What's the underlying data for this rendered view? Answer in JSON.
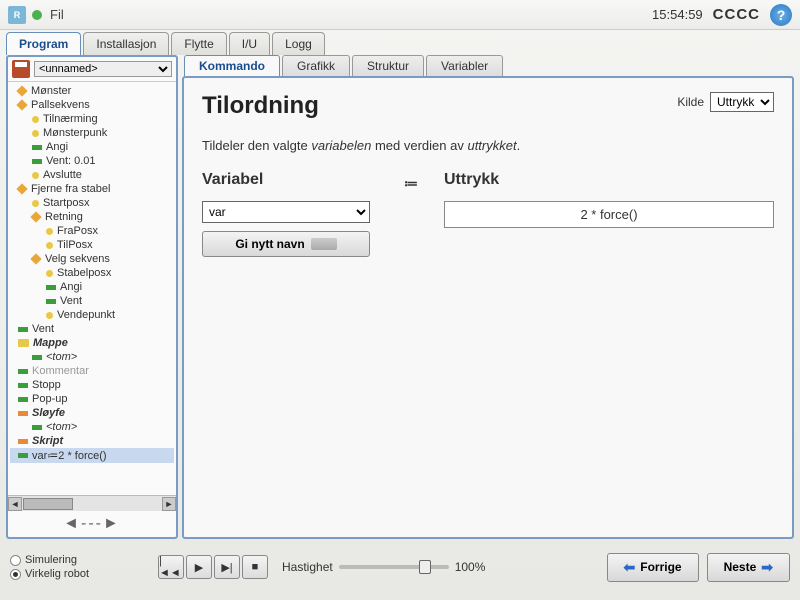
{
  "topbar": {
    "file_menu": "Fil",
    "clock": "15:54:59",
    "status_text": "CCCC",
    "help": "?"
  },
  "main_tabs": [
    "Program",
    "Installasjon",
    "Flytte",
    "I/U",
    "Logg"
  ],
  "program_name": "<unnamed>",
  "tree": [
    {
      "d": 0,
      "t": "diamond",
      "label": "Mønster"
    },
    {
      "d": 0,
      "t": "diamond",
      "label": "Pallsekvens"
    },
    {
      "d": 1,
      "t": "dot",
      "label": "Tilnærming"
    },
    {
      "d": 1,
      "t": "dot",
      "label": "Mønsterpunk"
    },
    {
      "d": 1,
      "t": "barg",
      "label": "Angi"
    },
    {
      "d": 1,
      "t": "barg",
      "label": "Vent: 0.01"
    },
    {
      "d": 1,
      "t": "dot",
      "label": "Avslutte"
    },
    {
      "d": 0,
      "t": "diamond",
      "label": "Fjerne fra stabel"
    },
    {
      "d": 1,
      "t": "dot",
      "label": "Startposx"
    },
    {
      "d": 1,
      "t": "diamond",
      "label": "Retning"
    },
    {
      "d": 2,
      "t": "dot",
      "label": "FraPosx"
    },
    {
      "d": 2,
      "t": "dot",
      "label": "TilPosx"
    },
    {
      "d": 1,
      "t": "diamond",
      "label": "Velg sekvens"
    },
    {
      "d": 2,
      "t": "dot",
      "label": "Stabelposx"
    },
    {
      "d": 2,
      "t": "barg",
      "label": "Angi"
    },
    {
      "d": 2,
      "t": "barg",
      "label": "Vent"
    },
    {
      "d": 2,
      "t": "dot",
      "label": "Vendepunkt"
    },
    {
      "d": 0,
      "t": "barg",
      "label": "Vent",
      "nodepth": true
    },
    {
      "d": 0,
      "t": "folder",
      "label": "Mappe",
      "bold": true,
      "nodepth": true
    },
    {
      "d": 1,
      "t": "barg",
      "label": "<tom>",
      "ital": true
    },
    {
      "d": 0,
      "t": "barg",
      "label": "Kommentar",
      "nodepth": true,
      "grey": true
    },
    {
      "d": 0,
      "t": "barg",
      "label": "Stopp",
      "nodepth": true
    },
    {
      "d": 0,
      "t": "barg",
      "label": "Pop-up",
      "nodepth": true
    },
    {
      "d": 0,
      "t": "baro",
      "label": "Sløyfe",
      "bold": true,
      "nodepth": true
    },
    {
      "d": 1,
      "t": "barg",
      "label": "<tom>",
      "ital": true
    },
    {
      "d": 0,
      "t": "baro",
      "label": "Skript",
      "bold": true,
      "nodepth": true
    },
    {
      "d": 0,
      "t": "barg",
      "label": "var≔2 * force()",
      "nodepth": true,
      "sel": true
    }
  ],
  "sub_tabs": [
    "Kommando",
    "Grafikk",
    "Struktur",
    "Variabler"
  ],
  "content": {
    "kilde_label": "Kilde",
    "kilde_value": "Uttrykk",
    "title": "Tilordning",
    "desc_1": "Tildeler den valgte ",
    "desc_var": "variabelen",
    "desc_2": " med verdien av ",
    "desc_expr": "uttrykket",
    "desc_3": ".",
    "var_heading": "Variabel",
    "expr_heading": "Uttrykk",
    "var_selected": "var",
    "rename": "Gi nytt navn",
    "assign_op": "≔",
    "expression": "2 * force()"
  },
  "footer": {
    "sim": "Simulering",
    "real": "Virkelig robot",
    "speed_label": "Hastighet",
    "speed_value": "100%",
    "prev": "Forrige",
    "next": "Neste"
  }
}
